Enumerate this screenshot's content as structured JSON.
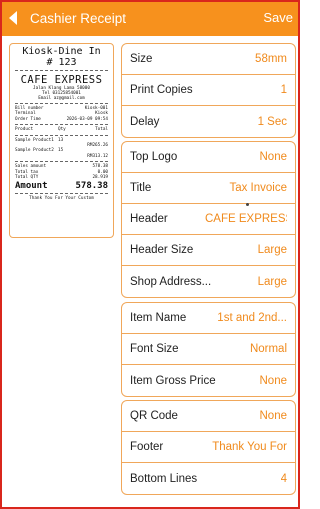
{
  "appbar": {
    "title": "Cashier Receipt",
    "save_label": "Save"
  },
  "receipt": {
    "kiosk_line": "Kiosk-Dine In",
    "order_number": "# 123",
    "shop_name": "CAFE EXPRESS",
    "address": "Jalan Klang Lama 58000",
    "tel": "Tel 03125854001",
    "email": "Email az@gmail.com",
    "info_rows": [
      {
        "label": "Bill number",
        "value": "Kiosk-001"
      },
      {
        "label": "Terminal",
        "value": "Kiosk"
      },
      {
        "label": "Order Time",
        "value": "2026-03-09 09:54"
      }
    ],
    "item_headers": {
      "product": "Product",
      "qty": "Qty",
      "total": "Total"
    },
    "items": [
      {
        "name": "Sample Product1",
        "qty": "13",
        "total": "RM265.26"
      },
      {
        "name": "Sample Product2",
        "qty": "15",
        "total": "RM313.12"
      }
    ],
    "summary_rows": [
      {
        "label": "Sales amount",
        "value": "578.38"
      },
      {
        "label": "Total tax",
        "value": "0.00"
      },
      {
        "label": "Total QTY",
        "value": "28.919"
      }
    ],
    "amount_label": "Amount",
    "amount_value": "578.38",
    "footer": "Thank You For Your Custom"
  },
  "groups": [
    {
      "rows": [
        {
          "label": "Size",
          "value": "58mm"
        },
        {
          "label": "Print Copies",
          "value": "1"
        },
        {
          "label": "Delay",
          "value": "1 Sec"
        }
      ]
    },
    {
      "rows": [
        {
          "label": "Top Logo",
          "value": "None"
        },
        {
          "label": "Title",
          "value": "Tax Invoice"
        },
        {
          "label": "Header",
          "value": "CAFE EXPRESS"
        },
        {
          "label": "Header Size",
          "value": "Large"
        },
        {
          "label": "Shop Address...",
          "value": "Large"
        }
      ]
    },
    {
      "rows": [
        {
          "label": "Item Name",
          "value": "1st and 2nd..."
        },
        {
          "label": "Font Size",
          "value": "Normal"
        },
        {
          "label": "Item Gross Price",
          "value": "None"
        }
      ]
    },
    {
      "rows": [
        {
          "label": "QR Code",
          "value": "None"
        },
        {
          "label": "Footer",
          "value": "Thank You For"
        },
        {
          "label": "Bottom Lines",
          "value": "4"
        }
      ]
    }
  ],
  "colors": {
    "accent": "#f7911d",
    "value_text": "#f08a1c",
    "border": "#f0a75a",
    "frame": "#d9261c"
  }
}
